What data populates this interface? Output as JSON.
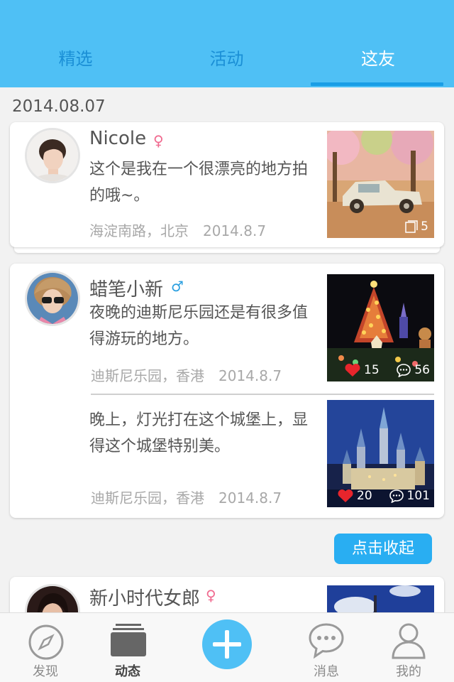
{
  "header": {
    "tabs": [
      {
        "label": "精选",
        "active": false
      },
      {
        "label": "活动",
        "active": false
      },
      {
        "label": "这友",
        "active": true
      }
    ],
    "accent_color": "#4fc0f5"
  },
  "feed": {
    "date": "2014.08.07",
    "posts": [
      {
        "user": "Nicole",
        "gender": "female",
        "gender_symbol": "♀",
        "text": "这个是我在一个很漂亮的地方拍的哦~。",
        "location": "海淀南路，北京",
        "date": "2014.8.7",
        "photo_icon": "photo-stack-icon",
        "photo_count": "5"
      },
      {
        "user": "蜡笔小新",
        "gender": "male",
        "gender_symbol": "♂",
        "entries": [
          {
            "text": "夜晚的迪斯尼乐园还是有很多值得游玩的地方。",
            "location": "迪斯尼乐园，香港",
            "date": "2014.8.7",
            "likes": "15",
            "comments": "56"
          },
          {
            "text": "晚上，灯光打在这个城堡上，显得这个城堡特别美。",
            "location": "迪斯尼乐园，香港",
            "date": "2014.8.7",
            "likes": "20",
            "comments": "101"
          }
        ]
      },
      {
        "user": "新小时代女郎",
        "gender": "female",
        "gender_symbol": "♀"
      }
    ],
    "collapse_label": "点击收起"
  },
  "bottom_nav": {
    "items": [
      {
        "label": "发现",
        "icon": "compass-icon"
      },
      {
        "label": "动态",
        "icon": "stack-icon",
        "active": true
      },
      {
        "label": "",
        "icon": "plus-icon"
      },
      {
        "label": "消息",
        "icon": "chat-bubble-icon"
      },
      {
        "label": "我的",
        "icon": "person-icon"
      }
    ]
  }
}
